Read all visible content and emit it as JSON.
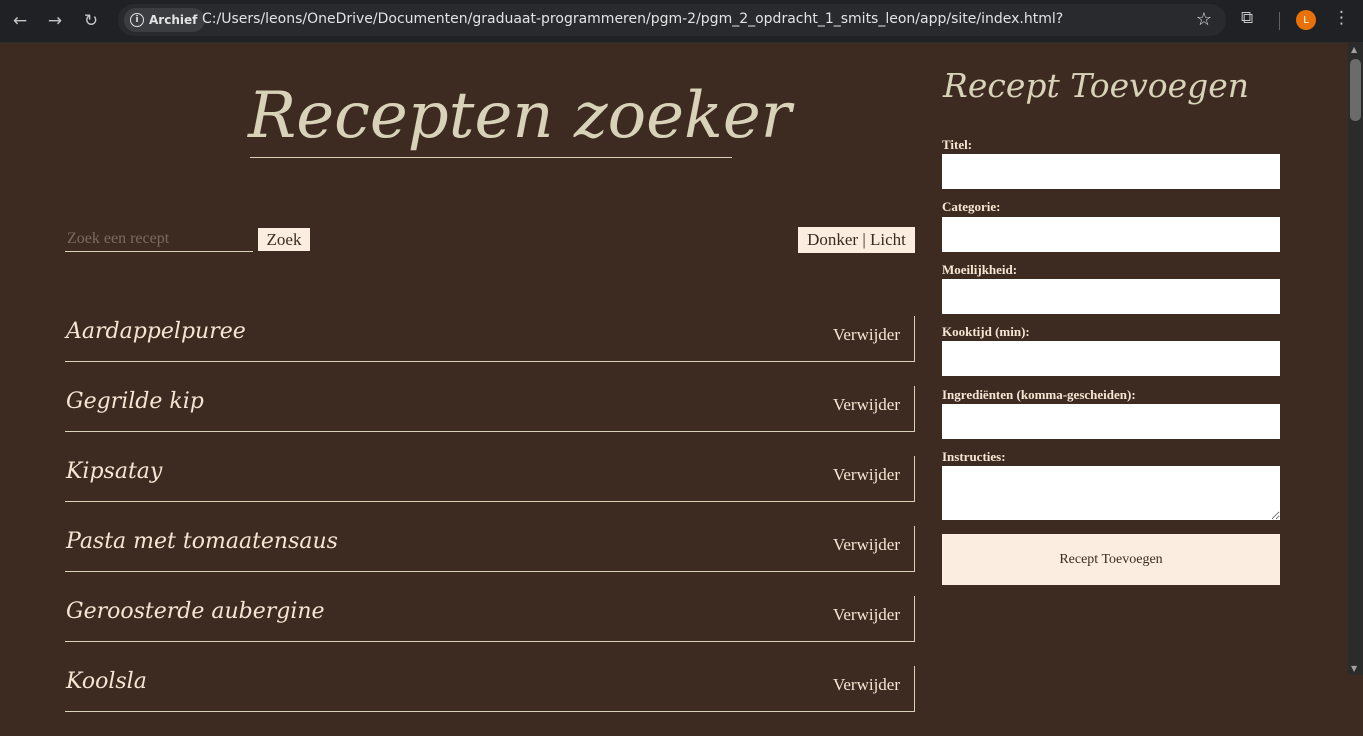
{
  "browser": {
    "chip_label": "Archief",
    "url": "C:/Users/leons/OneDrive/Documenten/graduaat-programmeren/pgm-2/pgm_2_opdracht_1_smits_leon/app/site/index.html?",
    "avatar_letter": "L",
    "icons": [
      "back-icon",
      "forward-icon",
      "reload-icon",
      "info-icon",
      "star-icon",
      "extensions-icon",
      "menu-icon"
    ]
  },
  "header": {
    "title": "Recepten zoeker"
  },
  "search": {
    "placeholder": "Zoek een recept",
    "value": "",
    "button_label": "Zoek"
  },
  "theme_toggle": {
    "label": "Donker | Licht"
  },
  "recipes": [
    {
      "name": "Aardappelpuree",
      "delete_label": "Verwijder"
    },
    {
      "name": "Gegrilde kip",
      "delete_label": "Verwijder"
    },
    {
      "name": "Kipsatay",
      "delete_label": "Verwijder"
    },
    {
      "name": "Pasta met tomaatensaus",
      "delete_label": "Verwijder"
    },
    {
      "name": "Geroosterde aubergine",
      "delete_label": "Verwijder"
    },
    {
      "name": "Koolsla",
      "delete_label": "Verwijder"
    }
  ],
  "form": {
    "title": "Recept Toevoegen",
    "fields": [
      {
        "label": "Titel:",
        "value": ""
      },
      {
        "label": "Categorie:",
        "value": ""
      },
      {
        "label": "Moeilijkheid:",
        "value": ""
      },
      {
        "label": "Kooktijd (min):",
        "value": ""
      },
      {
        "label": "Ingrediënten (komma-gescheiden):",
        "value": ""
      },
      {
        "label": "Instructies:",
        "value": ""
      }
    ],
    "submit_label": "Recept Toevoegen"
  },
  "colors": {
    "background": "#3d2b22",
    "title": "#d8d2b8",
    "text": "#f5e6d3",
    "button_bg": "#fbeee0"
  }
}
